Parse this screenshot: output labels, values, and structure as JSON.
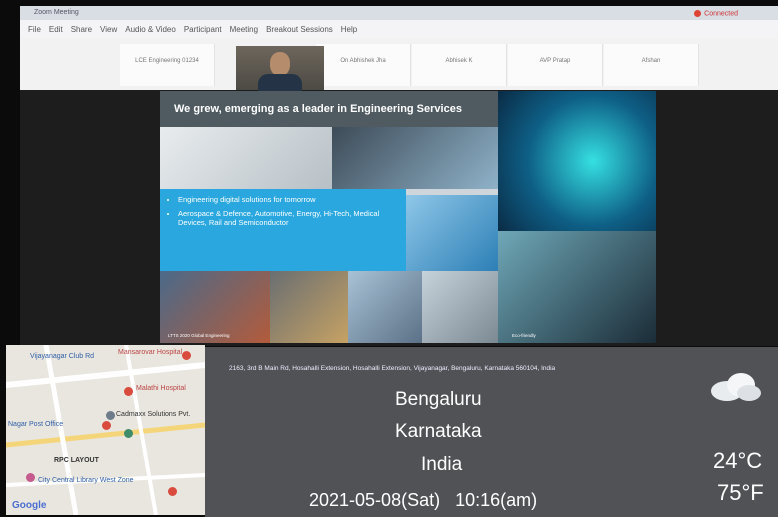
{
  "window": {
    "title": "Zoom Meeting",
    "menu": [
      "File",
      "Edit",
      "Share",
      "View",
      "Audio & Video",
      "Participant",
      "Meeting",
      "Breakout Sessions",
      "Help"
    ],
    "connection": "Connected"
  },
  "tiles": [
    "LCE Engineering 01234",
    "On Abhishek Jha",
    "Abhisek K",
    "AVP Pratap",
    "Afshan"
  ],
  "slide": {
    "heading": "We grew, emerging as a leader in Engineering Services",
    "bullets": [
      "Engineering digital solutions for tomorrow",
      "Aerospace & Defence, Automotive, Energy, Hi-Tech, Medical Devices, Rail and Semiconductor"
    ],
    "caption_left": "LTTS 2020 Global Engineering",
    "caption_right": "Eco-friendly"
  },
  "map": {
    "labels": [
      "Vijayanagar Club Rd",
      "Mansarovar Hospital",
      "Malathi Hospital",
      "Cadmaxx Solutions Pvt.",
      "Nagar Post Office",
      "RPC LAYOUT",
      "City Central Library West Zone",
      "Google"
    ],
    "brand": "Google"
  },
  "overlay": {
    "address": "2163, 3rd B Main Rd, Hosahalli Extension, Hosahalli Extension, Vijayanagar, Bengaluru, Karnataka 560104, India",
    "city": "Bengaluru",
    "state": "Karnataka",
    "country": "India",
    "datetime": "2021-05-08(Sat)   10:16(am)",
    "temp_c": "24°C",
    "temp_f": "75°F",
    "weather_icon": "cloud-icon"
  }
}
